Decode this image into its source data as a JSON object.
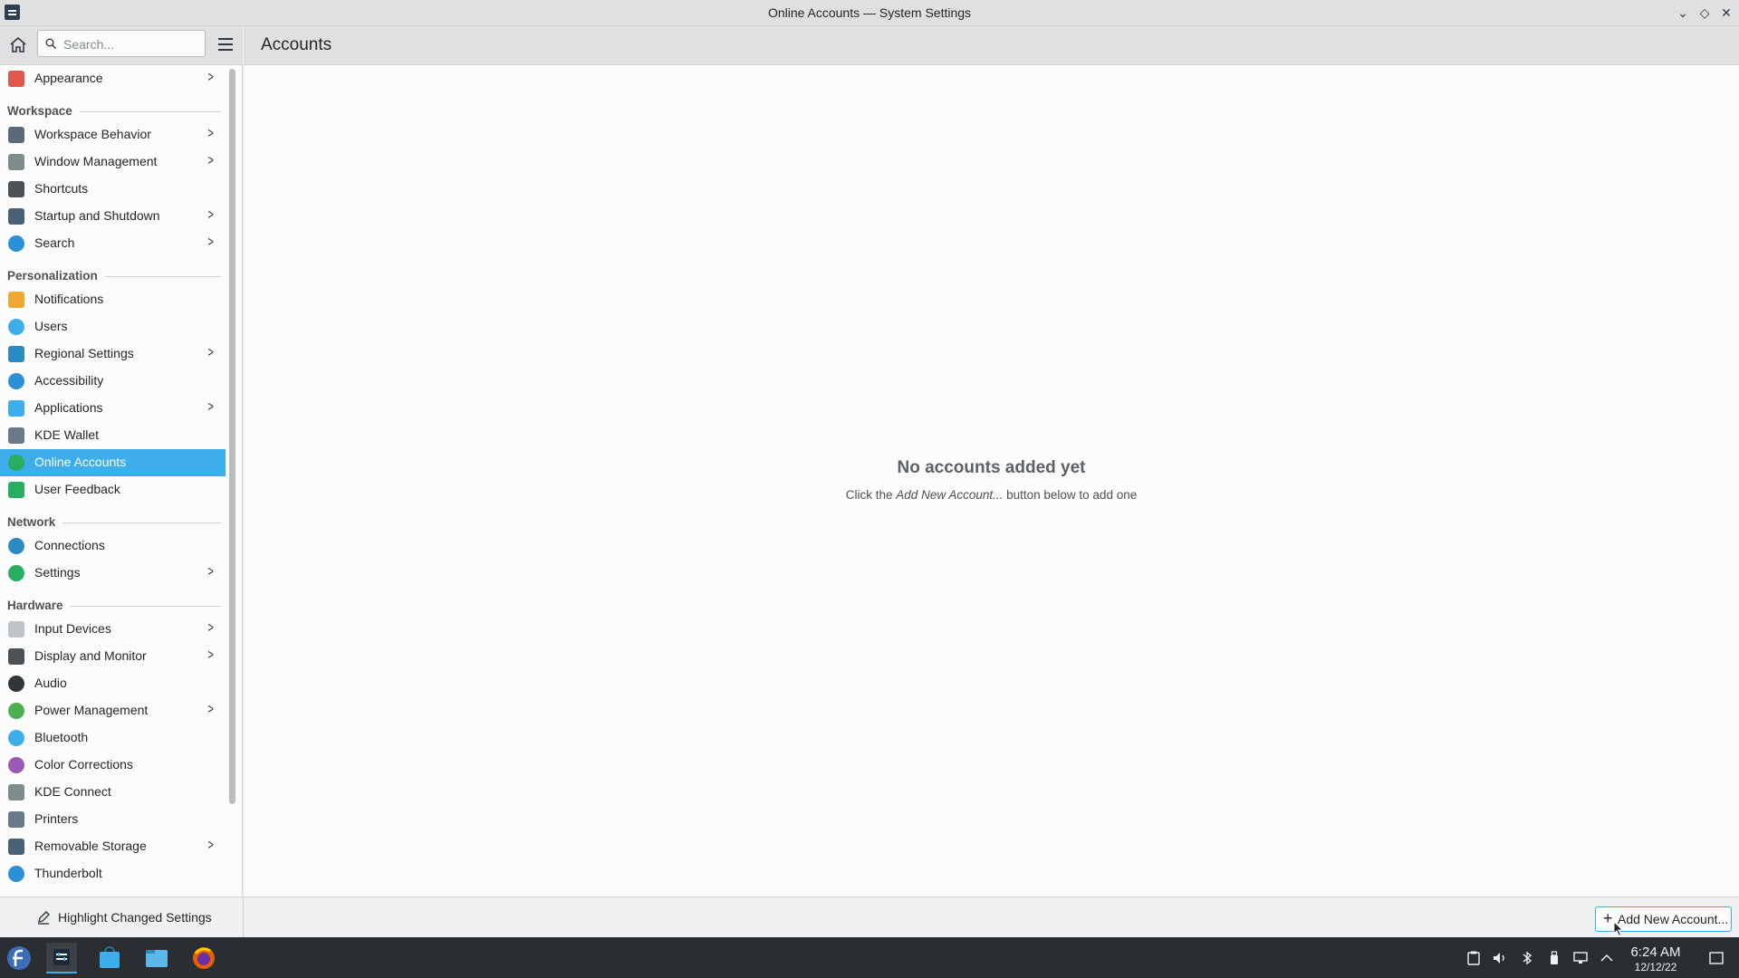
{
  "window": {
    "title": "Online Accounts — System Settings",
    "minimize_glyph": "⌄",
    "maximize_glyph": "◇",
    "close_glyph": "✕"
  },
  "search": {
    "placeholder": "Search..."
  },
  "sidebar": {
    "items": [
      {
        "type": "item",
        "label": "Appearance",
        "icon": "appearance-icon",
        "chevron": true
      },
      {
        "type": "category",
        "label": "Workspace"
      },
      {
        "type": "item",
        "label": "Workspace Behavior",
        "icon": "workspace-behavior-icon",
        "chevron": true
      },
      {
        "type": "item",
        "label": "Window Management",
        "icon": "window-management-icon",
        "chevron": true
      },
      {
        "type": "item",
        "label": "Shortcuts",
        "icon": "keyboard-icon",
        "chevron": false
      },
      {
        "type": "item",
        "label": "Startup and Shutdown",
        "icon": "startup-icon",
        "chevron": true
      },
      {
        "type": "item",
        "label": "Search",
        "icon": "search-settings-icon",
        "chevron": true
      },
      {
        "type": "category",
        "label": "Personalization"
      },
      {
        "type": "item",
        "label": "Notifications",
        "icon": "bell-icon",
        "chevron": false
      },
      {
        "type": "item",
        "label": "Users",
        "icon": "users-icon",
        "chevron": false
      },
      {
        "type": "item",
        "label": "Regional Settings",
        "icon": "regional-icon",
        "chevron": true
      },
      {
        "type": "item",
        "label": "Accessibility",
        "icon": "accessibility-icon",
        "chevron": false
      },
      {
        "type": "item",
        "label": "Applications",
        "icon": "applications-icon",
        "chevron": true
      },
      {
        "type": "item",
        "label": "KDE Wallet",
        "icon": "wallet-icon",
        "chevron": false
      },
      {
        "type": "item",
        "label": "Online Accounts",
        "icon": "online-accounts-icon",
        "chevron": false,
        "selected": true
      },
      {
        "type": "item",
        "label": "User Feedback",
        "icon": "feedback-icon",
        "chevron": false
      },
      {
        "type": "category",
        "label": "Network"
      },
      {
        "type": "item",
        "label": "Connections",
        "icon": "connections-icon",
        "chevron": false
      },
      {
        "type": "item",
        "label": "Settings",
        "icon": "network-settings-icon",
        "chevron": true
      },
      {
        "type": "category",
        "label": "Hardware"
      },
      {
        "type": "item",
        "label": "Input Devices",
        "icon": "mouse-icon",
        "chevron": true
      },
      {
        "type": "item",
        "label": "Display and Monitor",
        "icon": "monitor-icon",
        "chevron": true
      },
      {
        "type": "item",
        "label": "Audio",
        "icon": "audio-icon",
        "chevron": false
      },
      {
        "type": "item",
        "label": "Power Management",
        "icon": "power-icon",
        "chevron": true
      },
      {
        "type": "item",
        "label": "Bluetooth",
        "icon": "bluetooth-icon",
        "chevron": false
      },
      {
        "type": "item",
        "label": "Color Corrections",
        "icon": "color-icon",
        "chevron": false
      },
      {
        "type": "item",
        "label": "KDE Connect",
        "icon": "kde-connect-icon",
        "chevron": false
      },
      {
        "type": "item",
        "label": "Printers",
        "icon": "printer-icon",
        "chevron": false
      },
      {
        "type": "item",
        "label": "Removable Storage",
        "icon": "usb-icon",
        "chevron": true
      },
      {
        "type": "item",
        "label": "Thunderbolt",
        "icon": "thunderbolt-icon",
        "chevron": false
      }
    ]
  },
  "main": {
    "page_title": "Accounts",
    "empty_title": "No accounts added yet",
    "empty_sub_before": "Click the ",
    "empty_sub_em": "Add New Account...",
    "empty_sub_after": " button below to add one"
  },
  "footer": {
    "highlight_label": "Highlight Changed Settings",
    "add_label": "Add New Account..."
  },
  "taskbar": {
    "time": "6:24 AM",
    "date": "12/12/22"
  },
  "colors": {
    "accent": "#3daee9",
    "taskbar": "#2a2e32",
    "window_bg": "#eff0f1",
    "view_bg": "#fcfcfc"
  }
}
